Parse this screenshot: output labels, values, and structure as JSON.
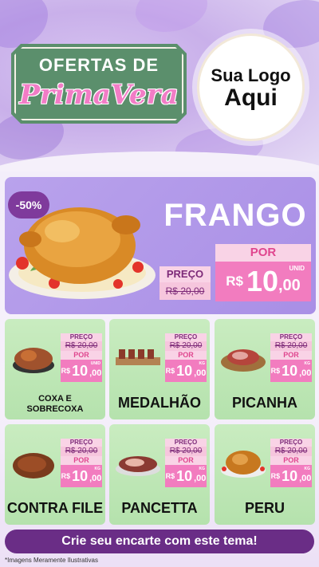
{
  "header": {
    "banner_top": "OFERTAS DE",
    "banner_bottom": "PrimaVera",
    "logo_line1": "Sua Logo",
    "logo_line2": "Aqui"
  },
  "hero": {
    "discount": "-50%",
    "title": "FRANGO",
    "preco_label": "PREÇO",
    "old_price": "R$ 20,00",
    "por_label": "POR",
    "currency": "R$",
    "price_int": "10",
    "price_dec": ",00",
    "unit": "UNID"
  },
  "cards": [
    {
      "name_l1": "COXA E",
      "name_l2": "SOBRECOXA",
      "preco_label": "PREÇO",
      "old_price": "R$ 20,00",
      "por_label": "POR",
      "currency": "R$",
      "price_int": "10",
      "price_dec": ",00",
      "unit": "UNID",
      "img": "chicken-drumstick-icon"
    },
    {
      "name_l1": "MEDALHÃO",
      "name_l2": "",
      "preco_label": "PREÇO",
      "old_price": "R$ 20,00",
      "por_label": "POR",
      "currency": "R$",
      "price_int": "10",
      "price_dec": ",00",
      "unit": "KG",
      "img": "skewers-icon"
    },
    {
      "name_l1": "PICANHA",
      "name_l2": "",
      "preco_label": "PREÇO",
      "old_price": "R$ 20,00",
      "por_label": "POR",
      "currency": "R$",
      "price_int": "10",
      "price_dec": ",00",
      "unit": "KG",
      "img": "picanha-icon"
    },
    {
      "name_l1": "CONTRA FILE",
      "name_l2": "",
      "preco_label": "PREÇO",
      "old_price": "R$ 20,00",
      "por_label": "POR",
      "currency": "R$",
      "price_int": "10",
      "price_dec": ",00",
      "unit": "KG",
      "img": "steak-icon"
    },
    {
      "name_l1": "PANCETTA",
      "name_l2": "",
      "preco_label": "PREÇO",
      "old_price": "R$ 20,00",
      "por_label": "POR",
      "currency": "R$",
      "price_int": "10",
      "price_dec": ",00",
      "unit": "KG",
      "img": "pancetta-icon"
    },
    {
      "name_l1": "PERU",
      "name_l2": "",
      "preco_label": "PREÇO",
      "old_price": "R$ 20,00",
      "por_label": "POR",
      "currency": "R$",
      "price_int": "10",
      "price_dec": ",00",
      "unit": "KG",
      "img": "turkey-icon"
    }
  ],
  "cta": "Crie seu encarte com este tema!",
  "footnote": "*Imagens Meramente Ilustrativas",
  "colors": {
    "purple": "#6a2d86",
    "pink": "#f27cbf",
    "green": "#b5e2ad",
    "lilac": "#a98fe6"
  }
}
